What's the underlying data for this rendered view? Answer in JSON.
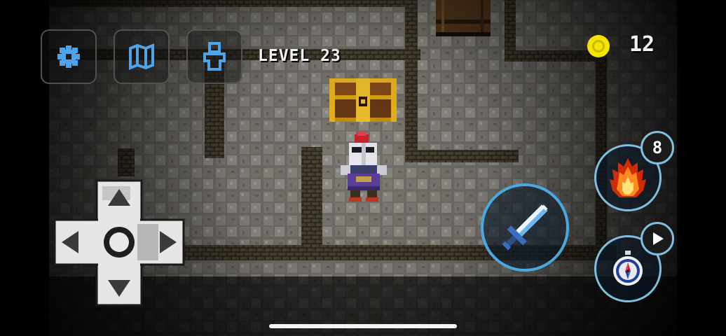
{
  "hud": {
    "settings_icon": "gear-icon",
    "map_icon": "map-icon",
    "character_icon": "character-icon",
    "level_label": "LEVEL 23"
  },
  "coins": {
    "icon": "coin-icon",
    "count": "12",
    "color": "#f5e400"
  },
  "actions": {
    "attack_icon": "sword-icon",
    "fire_icon": "fireball-icon",
    "fire_count": "8",
    "compass_icon": "compass-icon",
    "play_icon": "play-icon",
    "accent_color": "#4aa8e0"
  },
  "controls": {
    "dpad_icon": "dpad-icon"
  }
}
